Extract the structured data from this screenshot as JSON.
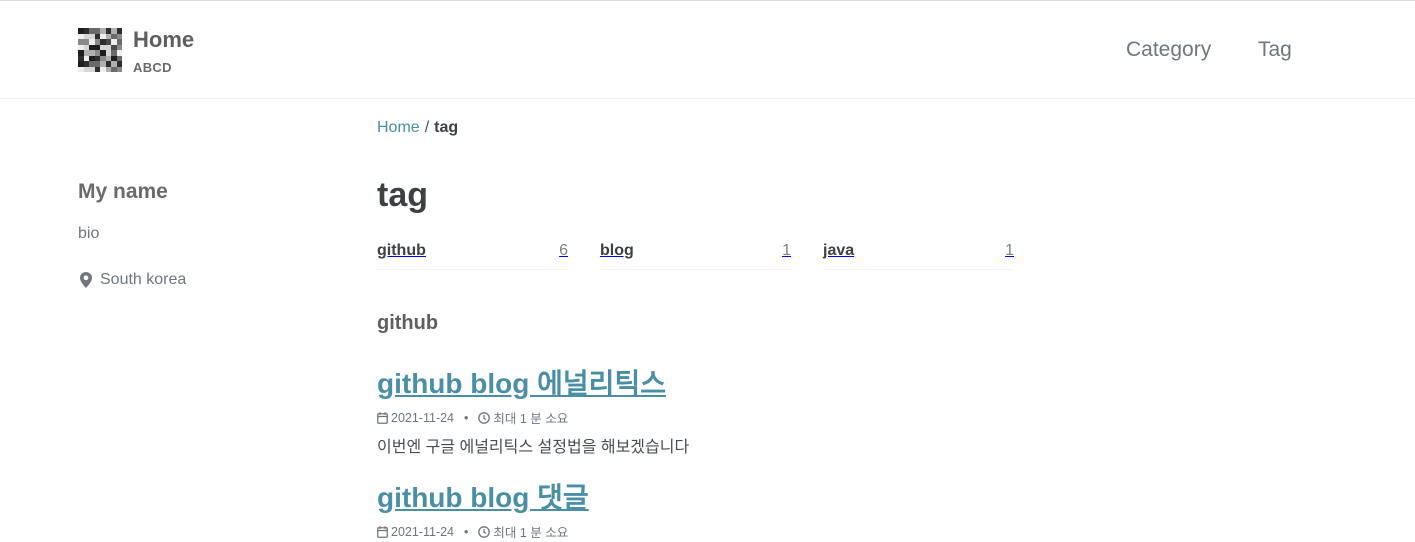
{
  "masthead": {
    "site_title": "Home",
    "site_subtitle": "ABCD",
    "nav": [
      {
        "label": "Category"
      },
      {
        "label": "Tag"
      }
    ]
  },
  "breadcrumb": {
    "home": "Home",
    "separator": "/",
    "current": "tag"
  },
  "sidebar": {
    "name": "My name",
    "bio": "bio",
    "location": "South korea",
    "location_icon": "map-marker-icon"
  },
  "page": {
    "title": "tag",
    "tags": [
      {
        "name": "github",
        "count": "6"
      },
      {
        "name": "blog",
        "count": "1"
      },
      {
        "name": "java",
        "count": "1"
      }
    ],
    "section_title": "github",
    "posts": [
      {
        "title": "github blog 에널리틱스",
        "date": "2021-11-24",
        "read_time": "최대 1 분 소요",
        "excerpt": "이번엔 구글 에널리틱스 설정법을 해보겠습니다"
      },
      {
        "title": "github blog 댓글",
        "date": "2021-11-24",
        "read_time": "최대 1 분 소요"
      }
    ]
  },
  "colors": {
    "link": "#4a8fa6",
    "text": "#494e52",
    "heading": "#3d4144"
  }
}
